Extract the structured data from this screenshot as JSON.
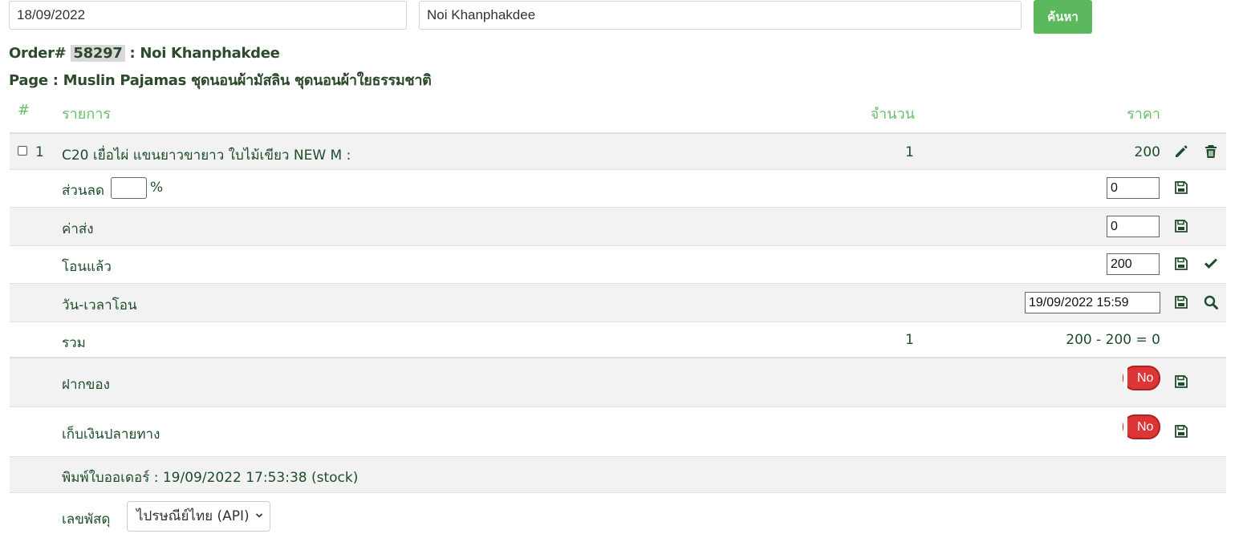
{
  "search": {
    "date_value": "18/09/2022",
    "name_value": "Noi Khanphakdee",
    "button_label": "ค้นหา"
  },
  "order": {
    "prefix": "Order#",
    "number": "58297",
    "separator": ":",
    "customer": "Noi Khanphakdee",
    "page_label": "Page : Muslin Pajamas ชุดนอนผ้ามัสลิน ชุดนอนผ้าใยธรรมชาติ"
  },
  "table": {
    "headers": {
      "index": "#",
      "item": "รายการ",
      "qty": "จำนวน",
      "price": "ราคา"
    },
    "items": [
      {
        "index": "1",
        "name": "C20 เยื่อไผ่ แขนยาวขายาว ใบไม้เขียว NEW M :",
        "qty": "1",
        "price": "200"
      }
    ],
    "discount": {
      "label": "ส่วนลด",
      "percent_value": "",
      "percent_sign": "%",
      "amount_value": "0"
    },
    "shipping": {
      "label": "ค่าส่ง",
      "value": "0"
    },
    "paid": {
      "label": "โอนแล้ว",
      "value": "200"
    },
    "transfer_time": {
      "label": "วัน-เวลาโอน",
      "value": "19/09/2022 15:59"
    },
    "total": {
      "label": "รวม",
      "qty": "1",
      "calc": "200 - 200 = 0"
    },
    "deposit": {
      "label": "ฝากของ",
      "toggle": "No"
    },
    "cod": {
      "label": "เก็บเงินปลายทาง",
      "toggle": "No"
    },
    "print_info": "พิมพ์ใบออเดอร์ : 19/09/2022 17:53:38 (stock)",
    "tracking": {
      "label": "เลขพัสดุ",
      "selected": "ไปรษณีย์ไทย (API)"
    }
  },
  "colors": {
    "header_text": "#6abf6a",
    "body_text": "#1e4d2b",
    "search_button": "#5cb85c",
    "toggle_no": "#dc3535",
    "row_gray": "#f2f2f2"
  },
  "icons": [
    "pencil-icon",
    "trash-icon",
    "save-icon",
    "check-icon",
    "search-icon",
    "chevron-down-icon"
  ]
}
